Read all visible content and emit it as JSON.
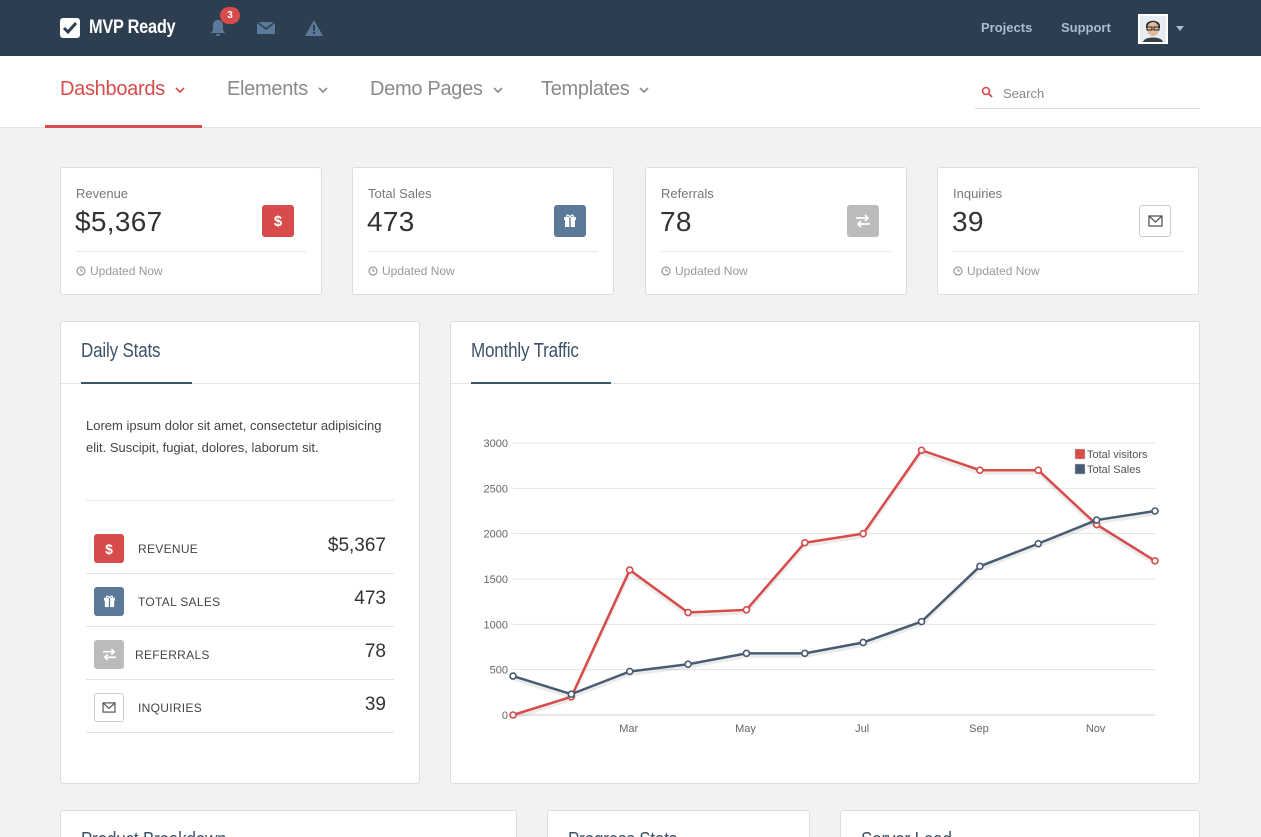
{
  "topbar": {
    "brand": "MVP Ready",
    "notification_count": "3",
    "links": [
      "Projects",
      "Support"
    ]
  },
  "nav": {
    "items": [
      "Dashboards",
      "Elements",
      "Demo Pages",
      "Templates"
    ],
    "active": "Dashboards",
    "search_placeholder": "Search"
  },
  "stats": [
    {
      "label": "Revenue",
      "value": "$5,367",
      "icon": "dollar-icon",
      "color": "#d74b4b",
      "footer": "Updated Now"
    },
    {
      "label": "Total Sales",
      "value": "473",
      "icon": "gift-icon",
      "color": "#5b7a99",
      "footer": "Updated Now"
    },
    {
      "label": "Referrals",
      "value": "78",
      "icon": "exchange-icon",
      "color": "#bbbbbb",
      "footer": "Updated Now"
    },
    {
      "label": "Inquiries",
      "value": "39",
      "icon": "envelope-icon",
      "color": "#ffffff",
      "footer": "Updated Now"
    }
  ],
  "daily_stats": {
    "title": "Daily Stats",
    "description": "Lorem ipsum dolor sit amet, consectetur adipisicing elit. Suscipit, fugiat, dolores, laborum sit.",
    "rows": [
      {
        "label": "REVENUE",
        "value": "$5,367"
      },
      {
        "label": "TOTAL SALES",
        "value": "473"
      },
      {
        "label": "REFERRALS",
        "value": "78"
      },
      {
        "label": "INQUIRIES",
        "value": "39"
      }
    ]
  },
  "monthly_traffic": {
    "title": "Monthly Traffic"
  },
  "chart_data": {
    "type": "line",
    "x_ticks": [
      "Mar",
      "May",
      "Jul",
      "Sep",
      "Nov"
    ],
    "ylim": [
      0,
      3000
    ],
    "y_ticks": [
      0,
      500,
      1000,
      1500,
      2000,
      2500,
      3000
    ],
    "grid": true,
    "legend_position": "top-right",
    "series": [
      {
        "name": "Total visitors",
        "color": "#d74b4b",
        "values": [
          0,
          200,
          1600,
          1130,
          1160,
          1900,
          2000,
          2920,
          2700,
          2700,
          2100,
          1700
        ]
      },
      {
        "name": "Total Sales",
        "color": "#485b73",
        "values": [
          430,
          230,
          480,
          560,
          680,
          680,
          800,
          1030,
          1640,
          1890,
          2150,
          2250
        ]
      }
    ]
  },
  "bottom_panels": [
    "Product Breakdown",
    "Progress Stats",
    "Server Load"
  ]
}
